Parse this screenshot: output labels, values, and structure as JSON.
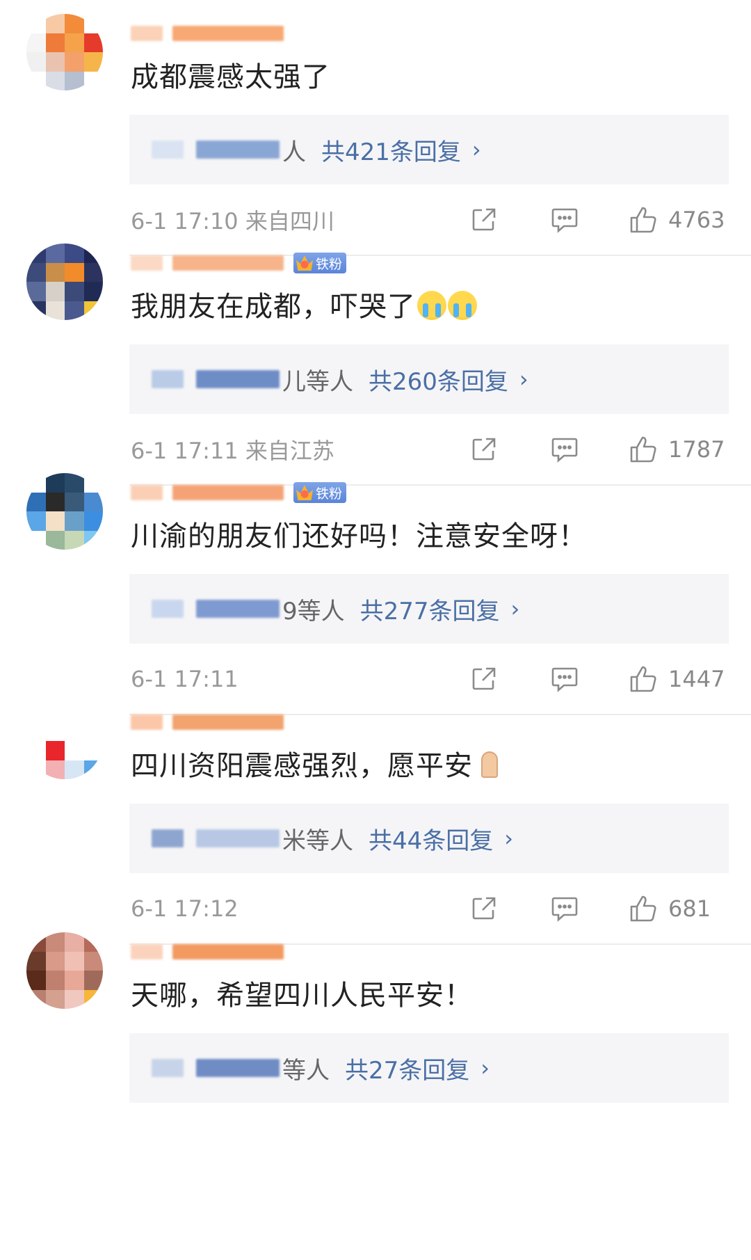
{
  "comments": [
    {
      "text": "成都震感太强了",
      "reply_suffix": "人",
      "reply_count": "共421条回复",
      "time": "6-1 17:10",
      "location": "来自四川",
      "likes": "4763",
      "badge": "",
      "emoji": "",
      "avatar_colors": [
        "#ffffff",
        "#f7c9a5",
        "#f28c3a",
        "#ffffff",
        "#f5f5f5",
        "#ee7b3a",
        "#f5a24b",
        "#e53b2a",
        "#f0f0f0",
        "#e9c3b0",
        "#f4a06a",
        "#f6b54a",
        "#ffffff",
        "#d9dde5",
        "#b5bfd0",
        "#ffffff"
      ],
      "name_colors": [
        "#fbd2b8",
        "#f7a873"
      ],
      "reply_name_colors": [
        "#d9e3f2",
        "#8aa6d4"
      ]
    },
    {
      "text": "我朋友在成都，吓哭了",
      "reply_suffix": "儿等人",
      "reply_count": "共260条回复",
      "time": "6-1 17:11",
      "location": "来自江苏",
      "likes": "1787",
      "badge": "铁粉",
      "emoji": "cry",
      "avatar_colors": [
        "#2f3b6e",
        "#5a6aa0",
        "#3c4a86",
        "#1e2552",
        "#3d4b7a",
        "#c98e4a",
        "#f28b2a",
        "#2c335e",
        "#5a6b9a",
        "#d7d0c8",
        "#3c4a7a",
        "#1f2a55",
        "#2a3463",
        "#e9e2d9",
        "#4a5a8e",
        "#f1c43a"
      ],
      "name_colors": [
        "#fbd9c4",
        "#f7b48a"
      ],
      "reply_name_colors": [
        "#b9cbe6",
        "#6e8cc6"
      ]
    },
    {
      "text": "川渝的朋友们还好吗！注意安全呀！",
      "reply_suffix": "9等人",
      "reply_count": "共277条回复",
      "time": "6-1 17:11",
      "location": "",
      "likes": "1447",
      "badge": "铁粉",
      "emoji": "",
      "avatar_colors": [
        "#ffffff",
        "#1e3b5a",
        "#2a4a6a",
        "#ffffff",
        "#2f6fb6",
        "#2a2a2a",
        "#3a5a7a",
        "#4a8ad0",
        "#5aa6e6",
        "#f3e0c6",
        "#6aa0c8",
        "#3c8ee0",
        "#ffffff",
        "#9ab89a",
        "#c6d8b6",
        "#7fc6f0"
      ],
      "name_colors": [
        "#fbcfb5",
        "#f5a376"
      ],
      "reply_name_colors": [
        "#c9d7ee",
        "#7f9ad0"
      ]
    },
    {
      "text": "四川资阳震感强烈，愿平安",
      "reply_suffix": "米等人",
      "reply_count": "共44条回复",
      "time": "6-1 17:12",
      "location": "",
      "likes": "681",
      "badge": "",
      "emoji": "pray",
      "avatar_colors": [
        "#ffffff",
        "#ffffff",
        "#ffffff",
        "#ffffff",
        "#ffffff",
        "#ffffff",
        "#ffffff",
        "#ffffff",
        "#ffffff",
        "#e8262c",
        "#ffffff",
        "#ffffff",
        "#ffffff",
        "#f3b0b3",
        "#d7e6f5",
        "#5aa6e6"
      ],
      "name_colors": [
        "#fbc7a8",
        "#f2a36e"
      ],
      "reply_name_colors": [
        "#8ea6cf",
        "#b8c8e4"
      ]
    },
    {
      "text": "天哪，希望四川人民平安！",
      "reply_suffix": "等人",
      "reply_count": "共27条回复",
      "time": "",
      "location": "",
      "likes": "",
      "badge": "",
      "emoji": "",
      "avatar_colors": [
        "#8a4a3a",
        "#c98a7a",
        "#e8b0a5",
        "#b56a5a",
        "#6a3a2a",
        "#d99a8a",
        "#f0c0b5",
        "#c98a7a",
        "#5a2a1a",
        "#c08070",
        "#e8a898",
        "#a06a5a",
        "#b88070",
        "#d4a090",
        "#f0c8c0",
        "#f6b73a"
      ],
      "name_colors": [
        "#fbd3bd",
        "#f29a60"
      ],
      "reply_name_colors": [
        "#c7d3e8",
        "#6f8cc4"
      ]
    }
  ],
  "icons": {
    "share": "share-icon",
    "comment": "comment-icon",
    "like": "thumb-up-icon"
  }
}
